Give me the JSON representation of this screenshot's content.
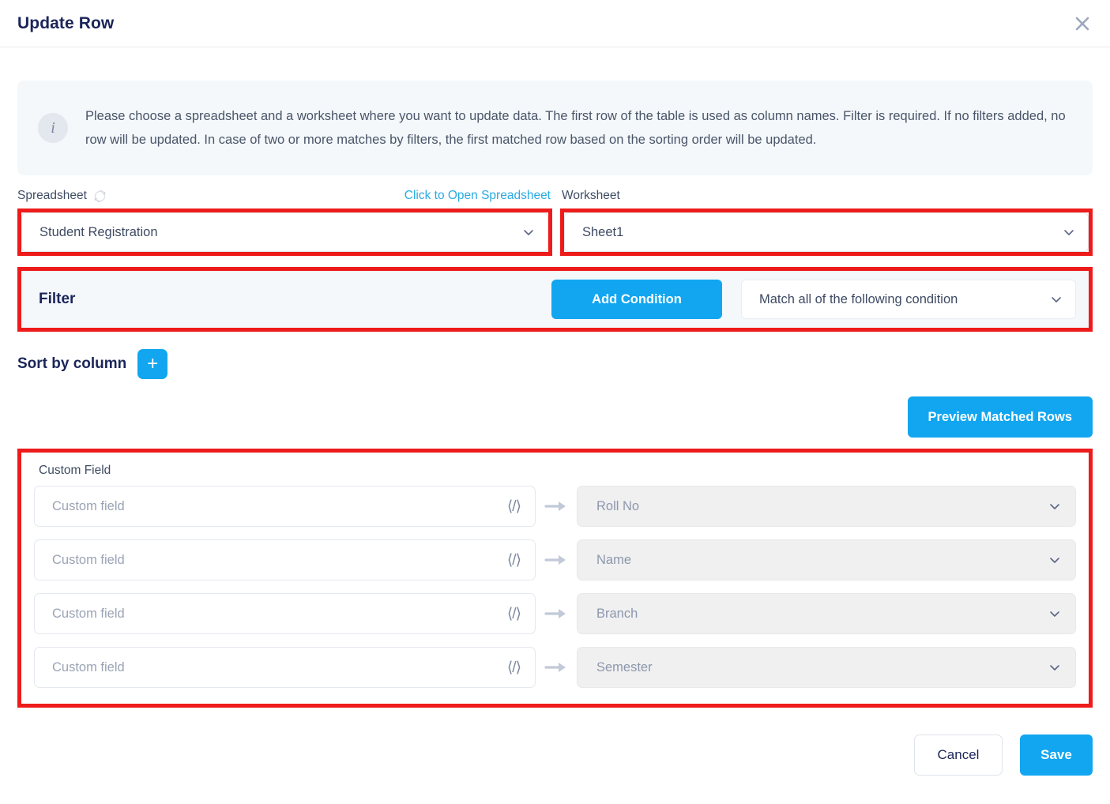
{
  "header": {
    "title": "Update Row",
    "close_icon": "close-icon"
  },
  "info": {
    "icon": "info-icon",
    "text": "Please choose a spreadsheet and a worksheet where you want to update data. The first row of the table is used as column names. Filter is required. If no filters added, no row will be updated. In case of two or more matches by filters, the first matched row based on the sorting order will be updated."
  },
  "source": {
    "spreadsheet_label": "Spreadsheet",
    "refresh_icon": "refresh-icon",
    "open_link": "Click to Open Spreadsheet",
    "worksheet_label": "Worksheet",
    "spreadsheet_value": "Student Registration",
    "worksheet_value": "Sheet1",
    "chevron_icon": "chevron-down-icon"
  },
  "filter": {
    "label": "Filter",
    "add_condition_label": "Add Condition",
    "match_value": "Match all of the following condition",
    "chevron_icon": "chevron-down-icon"
  },
  "sort": {
    "label": "Sort by column",
    "add_icon": "plus-icon"
  },
  "preview": {
    "label": "Preview Matched Rows"
  },
  "custom_field": {
    "title": "Custom Field",
    "input_placeholder": "Custom field",
    "code_icon": "code-icon",
    "arrow_icon": "arrow-right-icon",
    "chevron_icon": "chevron-down-icon",
    "rows": [
      {
        "placeholder": "Custom field",
        "column": "Roll No"
      },
      {
        "placeholder": "Custom field",
        "column": "Name"
      },
      {
        "placeholder": "Custom field",
        "column": "Branch"
      },
      {
        "placeholder": "Custom field",
        "column": "Semester"
      }
    ]
  },
  "footer": {
    "cancel_label": "Cancel",
    "save_label": "Save"
  },
  "colors": {
    "accent": "#12a6f0",
    "highlight": "#ee1b1b",
    "link": "#29abe2",
    "banner_bg": "#f4f8fb"
  }
}
